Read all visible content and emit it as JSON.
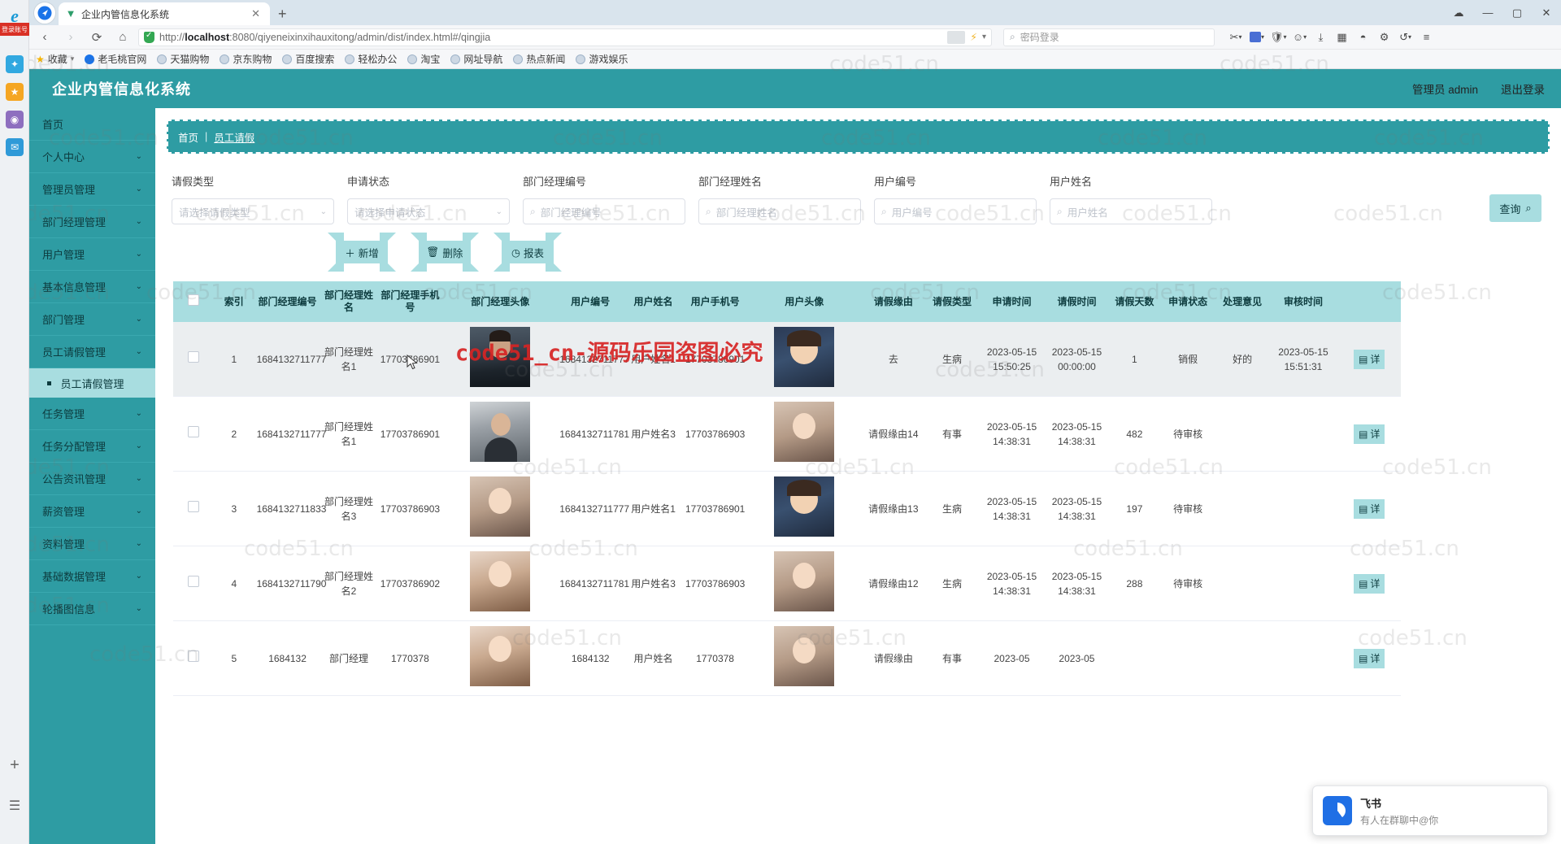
{
  "browser": {
    "tab_title": "企业内管信息化系统",
    "tab_favicon": "v-logo-icon",
    "new_tab_label": "+",
    "close_tab_label": "✕",
    "url_protocol": "http://",
    "url_host": "localhost",
    "url_rest": ":8080/qiyeneixinxihauxitong/admin/dist/index.html#/qingjia",
    "url_full": "http://localhost:8080/qiyeneixinxihauxitong/admin/dist/index.html#/qingjia",
    "search_placeholder": "密码登录",
    "window_minimize": "—",
    "window_maximize": "▢",
    "window_close": "✕",
    "rail_badge": "登录账号",
    "bookmarks": [
      {
        "label": "收藏",
        "icon": "star-icon"
      },
      {
        "label": "老毛桃官网",
        "icon": "globe-icon"
      },
      {
        "label": "天猫购物",
        "icon": "globe-icon"
      },
      {
        "label": "京东购物",
        "icon": "globe-icon"
      },
      {
        "label": "百度搜索",
        "icon": "globe-icon"
      },
      {
        "label": "轻松办公",
        "icon": "globe-icon"
      },
      {
        "label": "淘宝",
        "icon": "globe-icon"
      },
      {
        "label": "网址导航",
        "icon": "globe-icon"
      },
      {
        "label": "热点新闻",
        "icon": "globe-icon"
      },
      {
        "label": "游戏娱乐",
        "icon": "globe-icon"
      }
    ]
  },
  "app": {
    "title": "企业内管信息化系统",
    "admin_label": "管理员 admin",
    "logout_label": "退出登录",
    "accent": "#2e9ca3",
    "accent_light": "#a8dde0"
  },
  "sidebar": {
    "items": [
      {
        "label": "首页",
        "expandable": false
      },
      {
        "label": "个人中心",
        "expandable": true
      },
      {
        "label": "管理员管理",
        "expandable": true
      },
      {
        "label": "部门经理管理",
        "expandable": true
      },
      {
        "label": "用户管理",
        "expandable": true
      },
      {
        "label": "基本信息管理",
        "expandable": true
      },
      {
        "label": "部门管理",
        "expandable": true
      },
      {
        "label": "员工请假管理",
        "expandable": true
      }
    ],
    "active_sub": "员工请假管理",
    "items_after": [
      {
        "label": "任务管理",
        "expandable": true
      },
      {
        "label": "任务分配管理",
        "expandable": true
      },
      {
        "label": "公告资讯管理",
        "expandable": true
      },
      {
        "label": "薪资管理",
        "expandable": true
      },
      {
        "label": "资料管理",
        "expandable": true
      },
      {
        "label": "基础数据管理",
        "expandable": true
      },
      {
        "label": "轮播图信息",
        "expandable": true
      }
    ]
  },
  "breadcrumb": {
    "home": "首页",
    "separator": "|",
    "current": "员工请假"
  },
  "filters": [
    {
      "label": "请假类型",
      "placeholder": "请选择请假类型",
      "type": "select",
      "value": ""
    },
    {
      "label": "申请状态",
      "placeholder": "请选择申请状态",
      "type": "select",
      "value": ""
    },
    {
      "label": "部门经理编号",
      "placeholder": "部门经理编号",
      "type": "search",
      "value": ""
    },
    {
      "label": "部门经理姓名",
      "placeholder": "部门经理姓名",
      "type": "search",
      "value": ""
    },
    {
      "label": "用户编号",
      "placeholder": "用户编号",
      "type": "search",
      "value": ""
    },
    {
      "label": "用户姓名",
      "placeholder": "用户姓名",
      "type": "search",
      "value": ""
    }
  ],
  "search_button": {
    "label": "查询",
    "icon": "search-icon"
  },
  "toolbar": [
    {
      "label": "新增",
      "icon": "plus-icon"
    },
    {
      "label": "删除",
      "icon": "trash-icon"
    },
    {
      "label": "报表",
      "icon": "clock-icon"
    }
  ],
  "table": {
    "columns": [
      "索引",
      "部门经理编号",
      "部门经理姓名",
      "部门经理手机号",
      "部门经理头像",
      "用户编号",
      "用户姓名",
      "用户手机号",
      "用户头像",
      "请假缘由",
      "请假类型",
      "申请时间",
      "请假时间",
      "请假天数",
      "申请状态",
      "处理意见",
      "审核时间"
    ],
    "detail_button_label": "详",
    "rows": [
      {
        "index": "1",
        "mgr_no": "1684132711777",
        "mgr_name": "部门经理姓名1",
        "mgr_phone": "17703786901",
        "mgr_avatar": "p-man1",
        "user_no": "1684132711777",
        "user_name": "用户姓名1",
        "user_phone": "17703786901",
        "user_avatar": "p-anime",
        "reason": "去",
        "leave_type": "生病",
        "apply_time": "2023-05-15 15:50:25",
        "leave_time": "2023-05-15 00:00:00",
        "days": "1",
        "status": "销假",
        "opinion": "好的",
        "audit_time": "2023-05-15 15:51:31",
        "shaded": true
      },
      {
        "index": "2",
        "mgr_no": "1684132711777",
        "mgr_name": "部门经理姓名1",
        "mgr_phone": "17703786901",
        "mgr_avatar": "p-man2",
        "user_no": "1684132711781",
        "user_name": "用户姓名3",
        "user_phone": "17703786903",
        "user_avatar": "p-girl2",
        "reason": "请假缘由14",
        "leave_type": "有事",
        "apply_time": "2023-05-15 14:38:31",
        "leave_time": "2023-05-15 14:38:31",
        "days": "482",
        "status": "待审核",
        "opinion": "",
        "audit_time": "",
        "shaded": false
      },
      {
        "index": "3",
        "mgr_no": "1684132711833",
        "mgr_name": "部门经理姓名3",
        "mgr_phone": "17703786903",
        "mgr_avatar": "p-girl2",
        "user_no": "1684132711777",
        "user_name": "用户姓名1",
        "user_phone": "17703786901",
        "user_avatar": "p-anime",
        "reason": "请假缘由13",
        "leave_type": "生病",
        "apply_time": "2023-05-15 14:38:31",
        "leave_time": "2023-05-15 14:38:31",
        "days": "197",
        "status": "待审核",
        "opinion": "",
        "audit_time": "",
        "shaded": false
      },
      {
        "index": "4",
        "mgr_no": "1684132711790",
        "mgr_name": "部门经理姓名2",
        "mgr_phone": "17703786902",
        "mgr_avatar": "p-girl",
        "user_no": "1684132711781",
        "user_name": "用户姓名3",
        "user_phone": "17703786903",
        "user_avatar": "p-girl2",
        "reason": "请假缘由12",
        "leave_type": "生病",
        "apply_time": "2023-05-15 14:38:31",
        "leave_time": "2023-05-15 14:38:31",
        "days": "288",
        "status": "待审核",
        "opinion": "",
        "audit_time": "",
        "shaded": false
      },
      {
        "index": "5",
        "mgr_no": "1684132",
        "mgr_name": "部门经理",
        "mgr_phone": "1770378",
        "mgr_avatar": "p-girl",
        "user_no": "1684132",
        "user_name": "用户姓名",
        "user_phone": "1770378",
        "user_avatar": "p-girl2",
        "reason": "请假缘由",
        "leave_type": "有事",
        "apply_time": "2023-05",
        "leave_time": "2023-05",
        "days": "",
        "status": "",
        "opinion": "",
        "audit_time": "",
        "shaded": false
      }
    ]
  },
  "toast": {
    "title": "飞书",
    "message": "有人在群聊中@你",
    "icon": "feishu-icon"
  },
  "watermark": {
    "text": "code51.cn",
    "banner": "code51_cn-源码乐园盗图必究"
  }
}
